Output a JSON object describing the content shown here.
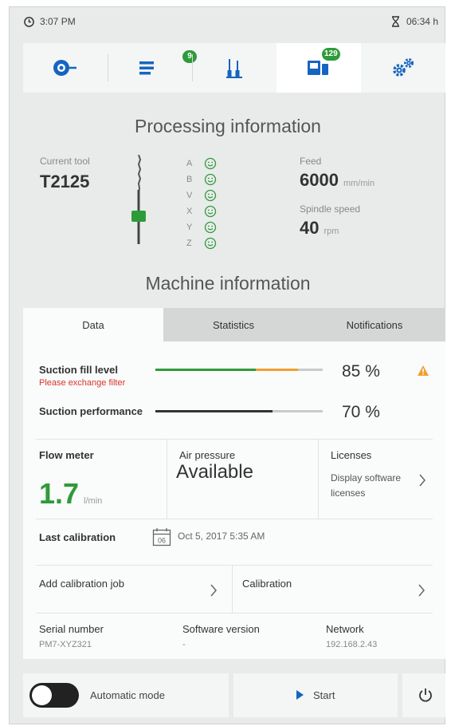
{
  "status": {
    "time": "3:07 PM",
    "timer": "06:34 h"
  },
  "nav": {
    "tabs": [
      {
        "name": "processing",
        "badge": ""
      },
      {
        "name": "jobs",
        "badge": "9"
      },
      {
        "name": "tools",
        "badge": ""
      },
      {
        "name": "machine",
        "badge": "129"
      },
      {
        "name": "settings",
        "badge": ""
      }
    ],
    "active_index": 3,
    "accent": "#1565c0"
  },
  "processing": {
    "title": "Processing information",
    "current_tool_label": "Current tool",
    "current_tool": "T2125",
    "axes": [
      "A",
      "B",
      "V",
      "X",
      "Y",
      "Z"
    ],
    "axis_status": "ok",
    "feed_label": "Feed",
    "feed_value": "6000",
    "feed_unit": "mm/min",
    "spindle_label": "Spindle speed",
    "spindle_value": "40",
    "spindle_unit": "rpm"
  },
  "machine": {
    "title": "Machine information",
    "tabs": [
      "Data",
      "Statistics",
      "Notifications"
    ],
    "active_tab": 0,
    "suction_fill": {
      "label": "Suction fill level",
      "warning": "Please exchange filter",
      "value": "85 %",
      "level": 0.85
    },
    "suction_perf": {
      "label": "Suction performance",
      "value": "70 %",
      "level": 0.7
    },
    "flow": {
      "label": "Flow meter",
      "value": "1.7",
      "unit": "l/min"
    },
    "air": {
      "label": "Air pressure",
      "value": "Available"
    },
    "licenses": {
      "label": "Licenses",
      "link": "Display software licenses"
    },
    "calibration_last": {
      "label": "Last calibration",
      "icon_day": "06",
      "value": "Oct 5, 2017 5:35 AM"
    },
    "add_calibration": "Add calibration job",
    "calibration": "Calibration",
    "serial": {
      "label": "Serial number",
      "value": "PM7-XYZ321"
    },
    "software": {
      "label": "Software version",
      "value": "-"
    },
    "network": {
      "label": "Network",
      "value": "192.168.2.43"
    }
  },
  "bottom": {
    "auto_mode": "Automatic mode",
    "start": "Start"
  },
  "colors": {
    "green": "#2e9b3a",
    "orange": "#f0a030",
    "warning_red": "#d9342b",
    "accent_blue": "#1565c0"
  }
}
